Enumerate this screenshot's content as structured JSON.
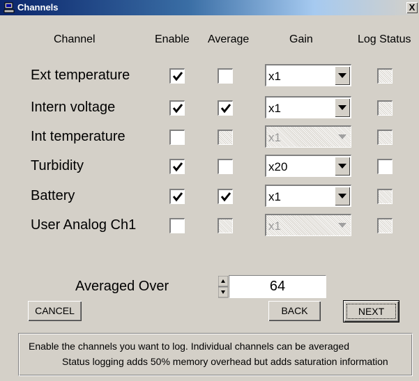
{
  "window": {
    "title": "Channels",
    "close_label": "X"
  },
  "headers": {
    "channel": "Channel",
    "enable": "Enable",
    "average": "Average",
    "gain": "Gain",
    "log_status": "Log Status"
  },
  "rows": [
    {
      "label": "Ext temperature",
      "enable": true,
      "enable_disabled": false,
      "average": false,
      "average_disabled": false,
      "gain": "x1",
      "gain_disabled": false,
      "log_status": false,
      "log_status_disabled": true
    },
    {
      "label": "Intern voltage",
      "enable": true,
      "enable_disabled": false,
      "average": true,
      "average_disabled": false,
      "gain": "x1",
      "gain_disabled": false,
      "log_status": false,
      "log_status_disabled": true
    },
    {
      "label": "Int temperature",
      "enable": false,
      "enable_disabled": false,
      "average": false,
      "average_disabled": true,
      "gain": "x1",
      "gain_disabled": true,
      "log_status": false,
      "log_status_disabled": true
    },
    {
      "label": "Turbidity",
      "enable": true,
      "enable_disabled": false,
      "average": false,
      "average_disabled": false,
      "gain": "x20",
      "gain_disabled": false,
      "log_status": false,
      "log_status_disabled": false
    },
    {
      "label": "Battery",
      "enable": true,
      "enable_disabled": false,
      "average": true,
      "average_disabled": false,
      "gain": "x1",
      "gain_disabled": false,
      "log_status": false,
      "log_status_disabled": true
    },
    {
      "label": "User Analog Ch1",
      "enable": false,
      "enable_disabled": false,
      "average": false,
      "average_disabled": true,
      "gain": "x1",
      "gain_disabled": true,
      "log_status": false,
      "log_status_disabled": true
    }
  ],
  "averaged_over": {
    "label": "Averaged Over",
    "value": "64"
  },
  "buttons": {
    "cancel": "CANCEL",
    "back": "BACK",
    "next": "NEXT"
  },
  "info": {
    "line1": "Enable the channels you want to log. Individual channels can be averaged",
    "line2": "Status logging adds 50% memory overhead but adds saturation information"
  }
}
